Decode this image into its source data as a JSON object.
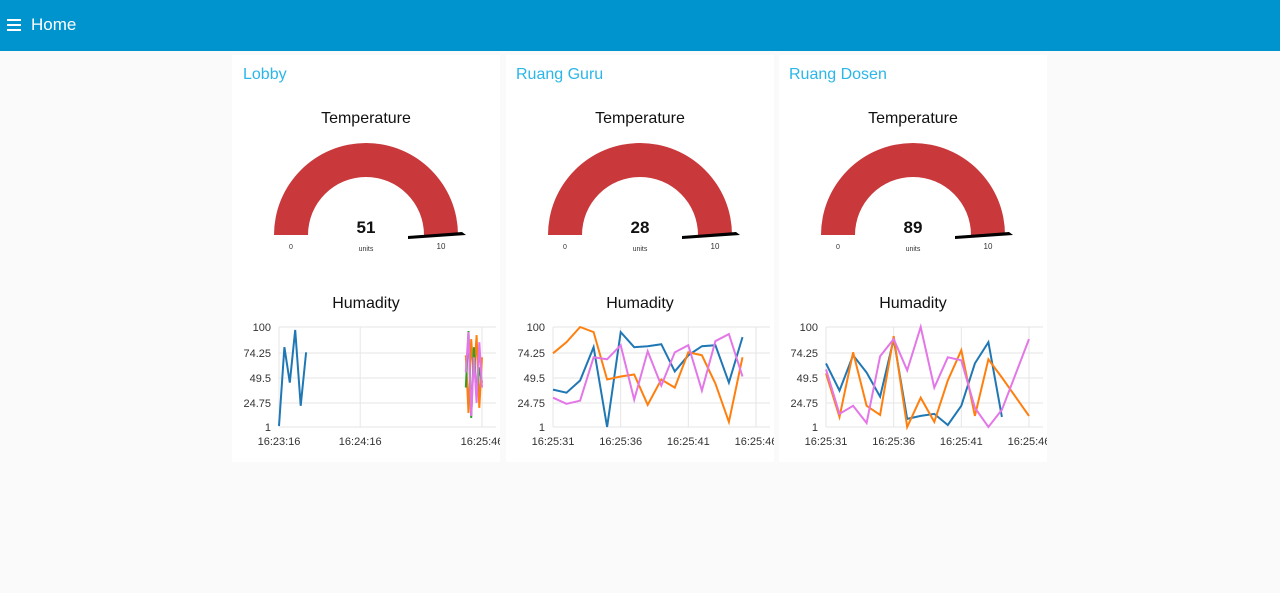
{
  "header": {
    "title": "Home",
    "menu_icon": "hamburger-menu-icon",
    "background": "#0094ce"
  },
  "colors": {
    "gauge_fill": "#c9383a",
    "gauge_needle": "#000000",
    "group_title": "#2bb6e8"
  },
  "groups": [
    {
      "title": "Lobby",
      "gauge": {
        "label": "Temperature",
        "value": "51",
        "units": "units",
        "min": "0",
        "max": "10"
      },
      "chart": {
        "label": "Humadity",
        "y_ticks": [
          "100",
          "74.25",
          "49.5",
          "24.75",
          "1"
        ],
        "x_ticks": [
          "16:23:16",
          "16:24:16",
          "16:25:46"
        ]
      }
    },
    {
      "title": "Ruang Guru",
      "gauge": {
        "label": "Temperature",
        "value": "28",
        "units": "units",
        "min": "0",
        "max": "10"
      },
      "chart": {
        "label": "Humadity",
        "y_ticks": [
          "100",
          "74.25",
          "49.5",
          "24.75",
          "1"
        ],
        "x_ticks": [
          "16:25:31",
          "16:25:36",
          "16:25:41",
          "16:25:46"
        ]
      }
    },
    {
      "title": "Ruang Dosen",
      "gauge": {
        "label": "Temperature",
        "value": "89",
        "units": "units",
        "min": "0",
        "max": "10"
      },
      "chart": {
        "label": "Humadity",
        "y_ticks": [
          "100",
          "74.25",
          "49.5",
          "24.75",
          "1"
        ],
        "x_ticks": [
          "16:25:31",
          "16:25:36",
          "16:25:41",
          "16:25:46"
        ]
      }
    }
  ],
  "chart_data": [
    {
      "type": "line",
      "ylim": [
        1,
        100
      ],
      "x": [
        "16:23:16",
        "16:23:20",
        "16:23:24",
        "16:23:28",
        "16:23:32",
        "16:23:36",
        "16:25:34",
        "16:25:36",
        "16:25:38",
        "16:25:40",
        "16:25:42",
        "16:25:44",
        "16:25:46"
      ],
      "series": [
        {
          "color": "#1f77b4",
          "values": [
            2,
            80,
            45,
            97,
            22,
            75,
            null,
            null,
            null,
            null,
            null,
            null,
            null
          ]
        },
        {
          "color": "#ff7f0e",
          "values": [
            null,
            null,
            null,
            null,
            null,
            null,
            72,
            15,
            88,
            50,
            92,
            20,
            70
          ]
        },
        {
          "color": "#2ca02c",
          "values": [
            null,
            null,
            null,
            null,
            null,
            null,
            40,
            96,
            10,
            80,
            30,
            60,
            45
          ]
        },
        {
          "color": "#e377e7",
          "values": [
            null,
            null,
            null,
            null,
            null,
            null,
            55,
            95,
            12,
            70,
            25,
            85,
            40
          ]
        }
      ]
    },
    {
      "type": "line",
      "ylim": [
        1,
        100
      ],
      "x": [
        "16:25:31",
        "16:25:32",
        "16:25:33",
        "16:25:34",
        "16:25:35",
        "16:25:36",
        "16:25:37",
        "16:25:38",
        "16:25:39",
        "16:25:40",
        "16:25:41",
        "16:25:42",
        "16:25:43",
        "16:25:44",
        "16:25:45",
        "16:25:46"
      ],
      "series": [
        {
          "color": "#1f77b4",
          "values": [
            38,
            35,
            47,
            80,
            1,
            95,
            80,
            81,
            83,
            56,
            72,
            81,
            82,
            45,
            90,
            null
          ]
        },
        {
          "color": "#ff7f0e",
          "values": [
            74,
            85,
            100,
            95,
            48,
            51,
            53,
            23,
            48,
            40,
            75,
            72,
            44,
            6,
            70,
            null
          ]
        },
        {
          "color": "#e377e7",
          "values": [
            30,
            24,
            27,
            70,
            68,
            82,
            28,
            76,
            42,
            75,
            82,
            37,
            86,
            93,
            51,
            null
          ]
        }
      ]
    },
    {
      "type": "line",
      "ylim": [
        1,
        100
      ],
      "x": [
        "16:25:31",
        "16:25:32",
        "16:25:33",
        "16:25:34",
        "16:25:35",
        "16:25:36",
        "16:25:37",
        "16:25:38",
        "16:25:39",
        "16:25:40",
        "16:25:41",
        "16:25:42",
        "16:25:43",
        "16:25:44",
        "16:25:46"
      ],
      "series": [
        {
          "color": "#1f77b4",
          "values": [
            64,
            37,
            72,
            55,
            31,
            88,
            9,
            12,
            14,
            3,
            22,
            64,
            85,
            11,
            null
          ]
        },
        {
          "color": "#ff7f0e",
          "values": [
            54,
            11,
            75,
            22,
            13,
            91,
            1,
            30,
            6,
            47,
            77,
            12,
            68,
            50,
            12
          ]
        },
        {
          "color": "#e377e7",
          "values": [
            58,
            14,
            22,
            5,
            71,
            88,
            57,
            100,
            40,
            70,
            67,
            20,
            1,
            18,
            88
          ]
        }
      ]
    }
  ]
}
